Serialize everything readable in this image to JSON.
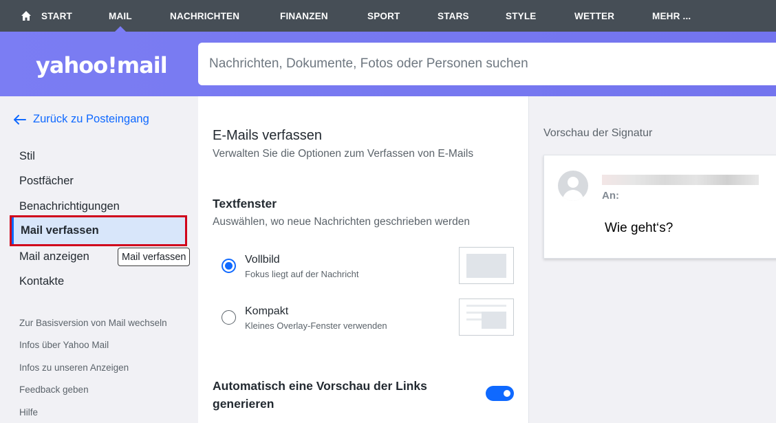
{
  "nav": {
    "items": [
      "START",
      "MAIL",
      "NACHRICHTEN",
      "FINANZEN",
      "SPORT",
      "STARS",
      "STYLE",
      "WETTER",
      "MEHR ..."
    ],
    "active": "MAIL"
  },
  "header": {
    "logo": "yahoo!mail",
    "search_placeholder": "Nachrichten, Dokumente, Fotos oder Personen suchen"
  },
  "sidebar": {
    "back_label": "Zurück zu Posteingang",
    "items": [
      "Stil",
      "Postfächer",
      "Benachrichtigungen",
      "Mail verfassen",
      "Mail anzeigen",
      "Kontakte"
    ],
    "active_item": "Mail verfassen",
    "tooltip": "Mail verfassen",
    "links": [
      "Zur Basisversion von Mail wechseln",
      "Infos über Yahoo Mail",
      "Infos zu unseren Anzeigen",
      "Feedback geben",
      "Hilfe"
    ]
  },
  "main": {
    "title": "E-Mails verfassen",
    "subtitle": "Verwalten Sie die Optionen zum Verfassen von E-Mails",
    "section_title": "Textfenster",
    "section_sub": "Auswählen, wo neue Nachrichten geschrieben werden",
    "options": [
      {
        "label": "Vollbild",
        "sub": "Fokus liegt auf der Nachricht",
        "selected": true
      },
      {
        "label": "Kompakt",
        "sub": "Kleines Overlay-Fenster verwenden",
        "selected": false
      }
    ],
    "toggle_label": "Automatisch eine Vorschau der Links generieren",
    "toggle_on": true
  },
  "preview": {
    "title": "Vorschau der Signatur",
    "to_label": "An:",
    "message": "Wie geht‘s?"
  },
  "colors": {
    "accent": "#0f69ff",
    "header": "#7b7df3",
    "topnav": "#464e56",
    "highlight_border": "#d0021b"
  }
}
